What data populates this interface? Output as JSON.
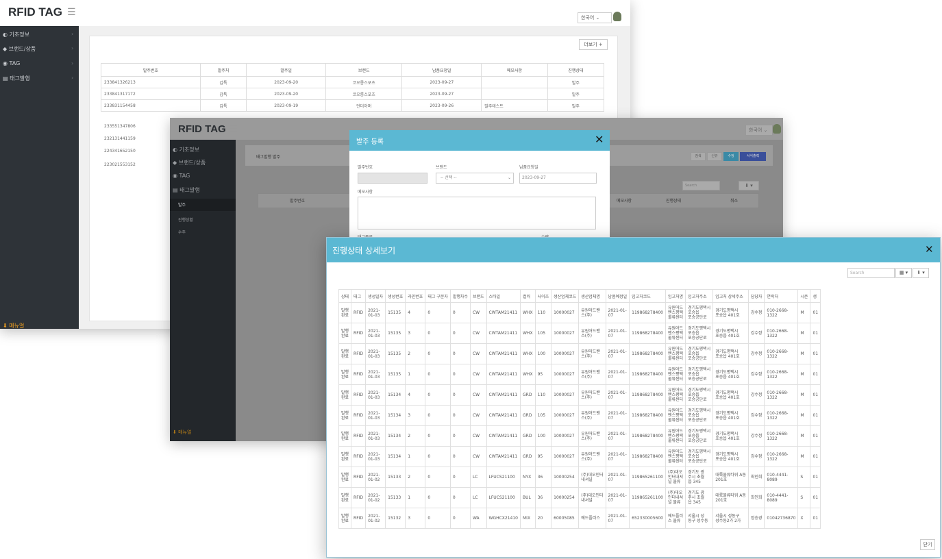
{
  "app": {
    "logo": "RFID TAG",
    "lang": "한국어",
    "sidebar": [
      "기초정보",
      "브랜드/상품",
      "TAG",
      "태그발행"
    ],
    "sidebar_sub": [
      "발주",
      "진행상황",
      "수주"
    ],
    "download": "매뉴얼"
  },
  "back": {
    "add_button": "더보기 +",
    "headers": [
      "발주번호",
      "발주처",
      "발주일",
      "브랜드",
      "납품요청일",
      "메모사항",
      "진행상태"
    ],
    "rows": [
      [
        "233841326213",
        "갑톡",
        "2023-09-20",
        "코오롱스포츠",
        "2023-09-27",
        "",
        "발주"
      ],
      [
        "233841317172",
        "갑톡",
        "2023-09-20",
        "코오롱스포츠",
        "2023-09-27",
        "",
        "발주"
      ],
      [
        "233831154458",
        "갑톡",
        "2023-09-19",
        "던더아머",
        "2023-09-26",
        "발주테스트",
        "발주"
      ]
    ],
    "extra_ids": [
      "233551347806",
      "232131441159",
      "224341652150",
      "223021553152"
    ]
  },
  "mid": {
    "section_title": "태그발행 발주",
    "buttons": [
      "검색",
      "신규",
      "수정",
      "서식출력"
    ],
    "search_placeholder": "Search",
    "headers": [
      "발주번호",
      "메모사항",
      "진행상태",
      "취소"
    ]
  },
  "order_modal": {
    "title": "발주 등록",
    "labels": {
      "order_no": "발주번호",
      "brand": "브랜드",
      "delivery": "납품요청일",
      "memo": "메모사항",
      "tag_type": "태그종류",
      "qty": "수량"
    },
    "brand_placeholder": "-- 선택 --",
    "delivery_value": "2023-09-27"
  },
  "detail": {
    "title": "진행상태 상세보기",
    "search_placeholder": "Search",
    "close_button": "닫기",
    "headers": [
      "상태",
      "태그",
      "생성일자",
      "생성번호",
      "라인번호",
      "태그 구분자",
      "발행차수",
      "브랜드",
      "스타일",
      "컬러",
      "사이즈",
      "생산업체코드",
      "생산업체명",
      "납품예정일",
      "입고처코드",
      "입고처명",
      "입고처주소",
      "입고처 상세주소",
      "담당자",
      "연락처",
      "시즌",
      "생"
    ],
    "rows": [
      [
        "발행\n완료",
        "RFID",
        "2021-\n01-03",
        "15135",
        "4",
        "0",
        "0",
        "CW",
        "CWTAM21411",
        "WHX",
        "110",
        "10000027",
        "유원어드밴\n스(주)",
        "2021-01-\n07",
        "119868278400",
        "유원어드\n밴스평택\n물류센터",
        "경기도평택시\n포승읍\n포승공단로",
        "경기도평택시\n포승읍 401호",
        "강수정",
        "010-2668-\n1322",
        "M",
        "01"
      ],
      [
        "발행\n완료",
        "RFID",
        "2021-\n01-03",
        "15135",
        "3",
        "0",
        "0",
        "CW",
        "CWTAM21411",
        "WHX",
        "105",
        "10000027",
        "유원어드밴\n스(주)",
        "2021-01-\n07",
        "119868278400",
        "유원어드\n밴스평택\n물류센터",
        "경기도평택시\n포승읍\n포승공단로",
        "경기도평택시\n포승읍 401호",
        "강수정",
        "010-2668-\n1322",
        "M",
        "01"
      ],
      [
        "발행\n완료",
        "RFID",
        "2021-\n01-03",
        "15135",
        "2",
        "0",
        "0",
        "CW",
        "CWTAM21411",
        "WHX",
        "100",
        "10000027",
        "유원어드밴\n스(주)",
        "2021-01-\n07",
        "119868278400",
        "유원어드\n밴스평택\n물류센터",
        "경기도평택시\n포승읍\n포승공단로",
        "경기도평택시\n포승읍 401호",
        "강수정",
        "010-2668-\n1322",
        "M",
        "01"
      ],
      [
        "발행\n완료",
        "RFID",
        "2021-\n01-03",
        "15135",
        "1",
        "0",
        "0",
        "CW",
        "CWTAM21411",
        "WHX",
        "95",
        "10000027",
        "유원어드밴\n스(주)",
        "2021-01-\n07",
        "119868278400",
        "유원어드\n밴스평택\n물류센터",
        "경기도평택시\n포승읍\n포승공단로",
        "경기도평택시\n포승읍 401호",
        "강수정",
        "010-2668-\n1322",
        "M",
        "01"
      ],
      [
        "발행\n완료",
        "RFID",
        "2021-\n01-03",
        "15134",
        "4",
        "0",
        "0",
        "CW",
        "CWTAM21411",
        "GRD",
        "110",
        "10000027",
        "유원어드밴\n스(주)",
        "2021-01-\n07",
        "119868278400",
        "유원어드\n밴스평택\n물류센터",
        "경기도평택시\n포승읍\n포승공단로",
        "경기도평택시\n포승읍 401호",
        "강수정",
        "010-2668-\n1322",
        "M",
        "01"
      ],
      [
        "발행\n완료",
        "RFID",
        "2021-\n01-03",
        "15134",
        "3",
        "0",
        "0",
        "CW",
        "CWTAM21411",
        "GRD",
        "105",
        "10000027",
        "유원어드밴\n스(주)",
        "2021-01-\n07",
        "119868278400",
        "유원어드\n밴스평택\n물류센터",
        "경기도평택시\n포승읍\n포승공단로",
        "경기도평택시\n포승읍 401호",
        "강수정",
        "010-2668-\n1322",
        "M",
        "01"
      ],
      [
        "발행\n완료",
        "RFID",
        "2021-\n01-03",
        "15134",
        "2",
        "0",
        "0",
        "CW",
        "CWTAM21411",
        "GRD",
        "100",
        "10000027",
        "유원어드밴\n스(주)",
        "2021-01-\n07",
        "119868278400",
        "유원어드\n밴스평택\n물류센터",
        "경기도평택시\n포승읍\n포승공단로",
        "경기도평택시\n포승읍 401호",
        "강수정",
        "010-2668-\n1322",
        "M",
        "01"
      ],
      [
        "발행\n완료",
        "RFID",
        "2021-\n01-03",
        "15134",
        "1",
        "0",
        "0",
        "CW",
        "CWTAM21411",
        "GRD",
        "95",
        "10000027",
        "유원어드밴\n스(주)",
        "2021-01-\n07",
        "119868278400",
        "유원어드\n밴스평택\n물류센터",
        "경기도평택시\n포승읍\n포승공단로",
        "경기도평택시\n포승읍 401호",
        "강수정",
        "010-2668-\n1322",
        "M",
        "01"
      ],
      [
        "발행\n완료",
        "RFID",
        "2021-\n01-02",
        "15133",
        "2",
        "0",
        "0",
        "LC",
        "LFUCS21100",
        "NYX",
        "36",
        "10000254",
        "(주)대오인터\n내셔널",
        "2021-01-\n07",
        "119865261100",
        "(주)대오\n인터내셔\n널 물류",
        "경기도 광\n주시 초월\n읍 345",
        "대륙물류타워 A동\n201호",
        "최인희",
        "010-4441-\n8089",
        "S",
        "01"
      ],
      [
        "발행\n완료",
        "RFID",
        "2021-\n01-02",
        "15133",
        "1",
        "0",
        "0",
        "LC",
        "LFUCS21100",
        "BUL",
        "36",
        "10000254",
        "(주)대오인터\n내셔널",
        "2021-01-\n07",
        "119865261100",
        "(주)대오\n인터내셔\n널 물류",
        "경기도 광\n주시 초월\n읍 345",
        "대륙물류타워 A동\n201호",
        "최인희",
        "010-4441-\n8089",
        "S",
        "01"
      ],
      [
        "발행\n완료",
        "RFID",
        "2021-\n01-02",
        "15132",
        "3",
        "0",
        "0",
        "WA",
        "WGHCX21410",
        "MIX",
        "20",
        "60005085",
        "에드플러스",
        "2021-01-\n07",
        "652330005600",
        "에드플러\n스 물류",
        "서울시 성\n동구 성수동",
        "서울시 성동구\n성수동2가 2가",
        "정승경",
        "01042736870",
        "X",
        "01"
      ]
    ]
  }
}
